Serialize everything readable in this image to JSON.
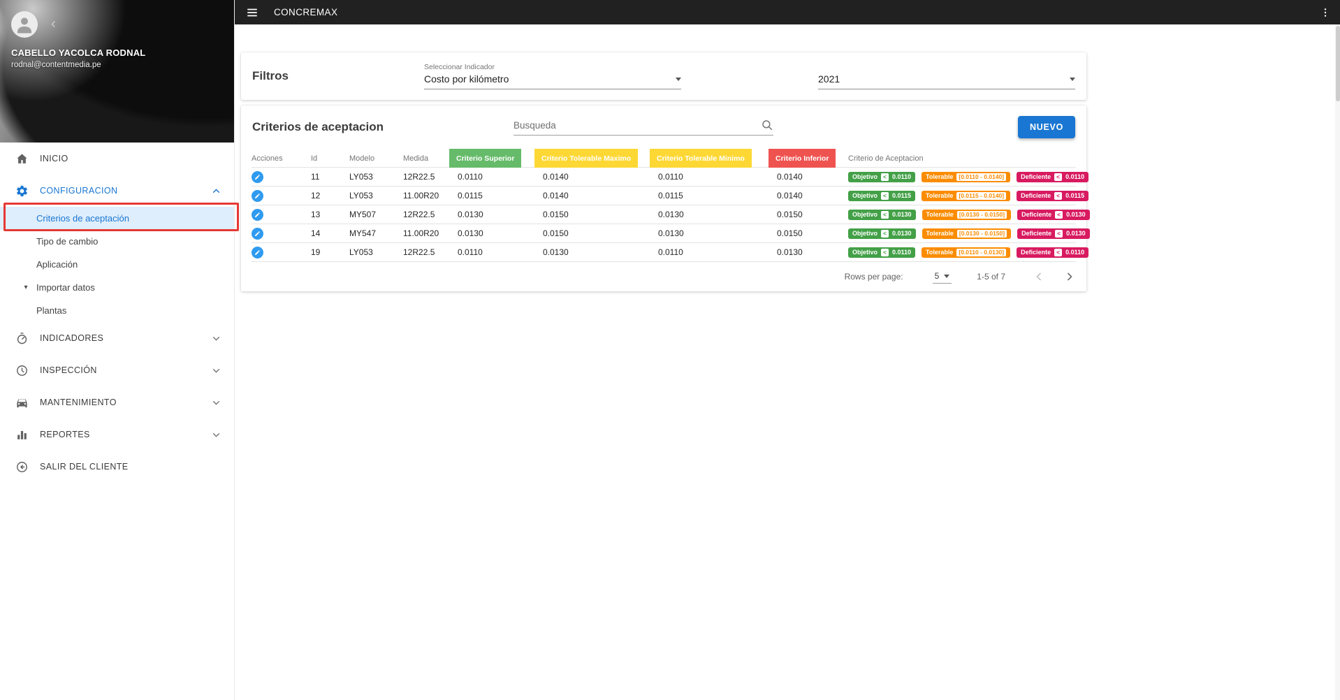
{
  "appbar": {
    "title": "CONCREMAX"
  },
  "profile": {
    "name": "CABELLO YACOLCA RODNAL",
    "email": "rodnal@contentmedia.pe"
  },
  "sidebar": {
    "inicio": "INICIO",
    "configuracion": "CONFIGURACION",
    "config_children": [
      {
        "label": "Criterios de aceptación"
      },
      {
        "label": "Tipo de cambio"
      },
      {
        "label": "Aplicación"
      },
      {
        "label": "Importar datos"
      },
      {
        "label": "Plantas"
      }
    ],
    "items": [
      {
        "label": "INDICADORES"
      },
      {
        "label": "INSPECCIÓN"
      },
      {
        "label": "MANTENIMIENTO"
      },
      {
        "label": "REPORTES"
      },
      {
        "label": "SALIR DEL CLIENTE"
      }
    ]
  },
  "filters": {
    "title": "Filtros",
    "indicator_label": "Seleccionar Indicador",
    "indicator_value": "Costo por kilómetro",
    "year_value": "2021"
  },
  "criteria": {
    "title": "Criterios de aceptacion",
    "search_placeholder": "Busqueda",
    "new_button_label": "NUEVO",
    "columns": {
      "acciones": "Acciones",
      "id": "Id",
      "modelo": "Modelo",
      "medida": "Medida",
      "superior": "Criterio Superior",
      "tol_max": "Criterio Tolerable Maximo",
      "tol_min": "Criterio Tolerable Minimo",
      "inferior": "Criterio Inferior",
      "aceptacion": "Criterio de Aceptacion"
    },
    "badge_labels": {
      "objetivo": "Objetivo",
      "tolerable": "Tolerable",
      "deficiente": "Deficiente",
      "lt": "<"
    },
    "rows": [
      {
        "id": "11",
        "modelo": "LY053",
        "medida": "12R22.5",
        "superior": "0.0110",
        "tol_max": "0.0140",
        "tol_min": "0.0110",
        "inferior": "0.0140",
        "objetivo_value": "0.0110",
        "tolerable_range": "[0.0110 - 0.0140]",
        "deficiente_value": "0.0110"
      },
      {
        "id": "12",
        "modelo": "LY053",
        "medida": "11.00R20",
        "superior": "0.0115",
        "tol_max": "0.0140",
        "tol_min": "0.0115",
        "inferior": "0.0140",
        "objetivo_value": "0.0115",
        "tolerable_range": "[0.0115 - 0.0140]",
        "deficiente_value": "0.0115"
      },
      {
        "id": "13",
        "modelo": "MY507",
        "medida": "12R22.5",
        "superior": "0.0130",
        "tol_max": "0.0150",
        "tol_min": "0.0130",
        "inferior": "0.0150",
        "objetivo_value": "0.0130",
        "tolerable_range": "[0.0130 - 0.0150]",
        "deficiente_value": "0.0130"
      },
      {
        "id": "14",
        "modelo": "MY547",
        "medida": "11.00R20",
        "superior": "0.0130",
        "tol_max": "0.0150",
        "tol_min": "0.0130",
        "inferior": "0.0150",
        "objetivo_value": "0.0130",
        "tolerable_range": "[0.0130 - 0.0150]",
        "deficiente_value": "0.0130"
      },
      {
        "id": "19",
        "modelo": "LY053",
        "medida": "12R22.5",
        "superior": "0.0110",
        "tol_max": "0.0130",
        "tol_min": "0.0110",
        "inferior": "0.0130",
        "objetivo_value": "0.0110",
        "tolerable_range": "[0.0110 - 0.0130]",
        "deficiente_value": "0.0110"
      }
    ],
    "pagination": {
      "rows_per_page_label": "Rows per page:",
      "rows_per_page": "5",
      "range": "1-5 of 7"
    }
  },
  "icons": {
    "dropdown_caret": "▾",
    "profile_collapse": "‹"
  },
  "colors": {
    "appbar_bg": "#212121",
    "accent_blue": "#1976d2",
    "selected_item_bg": "#dfeefc",
    "header_green": "#66bb6a",
    "header_yellow": "#fdd835",
    "header_red": "#ef5350",
    "badge_green": "#43a047",
    "badge_orange": "#fb8c00",
    "badge_pink": "#d81b60",
    "annotation_red": "#e53935"
  }
}
